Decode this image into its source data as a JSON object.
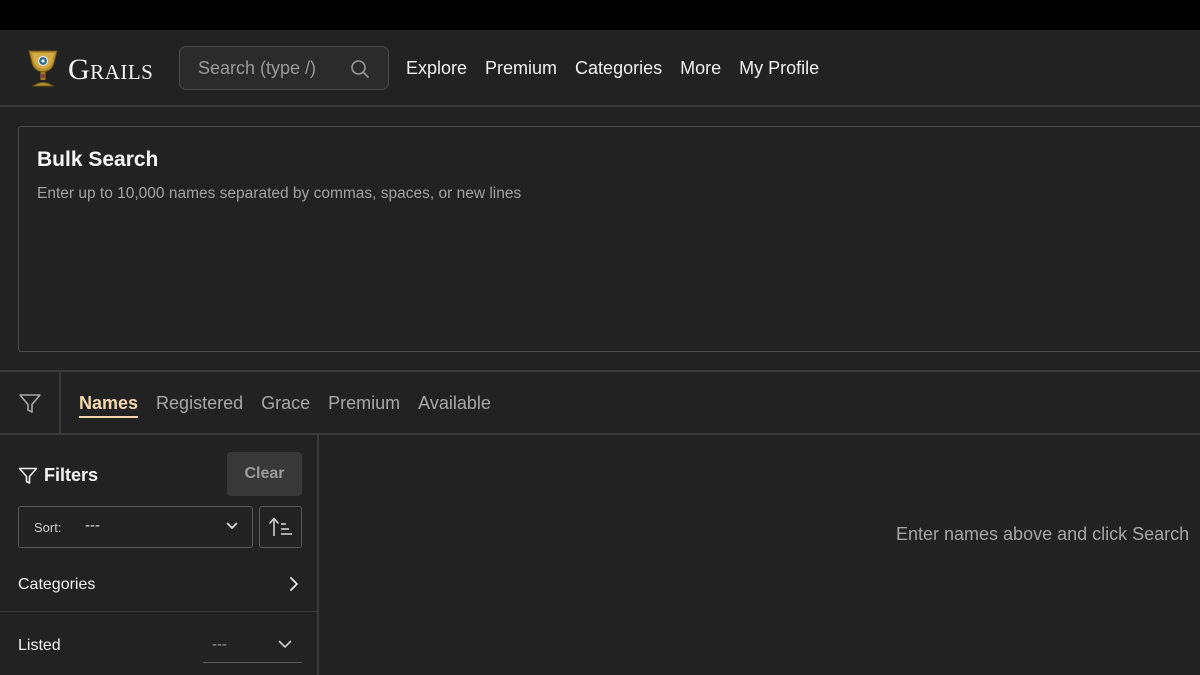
{
  "brand": {
    "name": "Grails",
    "logo_icon": "grail-chalice-icon"
  },
  "search": {
    "placeholder": "Search (type /)",
    "icon": "search-icon"
  },
  "nav": {
    "items": [
      "Explore",
      "Premium",
      "Categories",
      "More",
      "My Profile"
    ]
  },
  "bulk_search": {
    "title": "Bulk Search",
    "placeholder": "Enter up to 10,000 names separated by commas, spaces, or new lines"
  },
  "tabs": {
    "active": "Names",
    "items": [
      "Names",
      "Registered",
      "Grace",
      "Premium",
      "Available"
    ]
  },
  "filters": {
    "title": "Filters",
    "clear_label": "Clear",
    "sort_label": "Sort:",
    "sort_value": "---",
    "categories_label": "Categories",
    "listed_label": "Listed",
    "listed_value": "---"
  },
  "results": {
    "empty_message": "Enter names above and click Search"
  },
  "colors": {
    "background": "#222222",
    "active_tab": "#f3d8ad",
    "border": "#3a3a3a",
    "top_bar": "#000000"
  }
}
